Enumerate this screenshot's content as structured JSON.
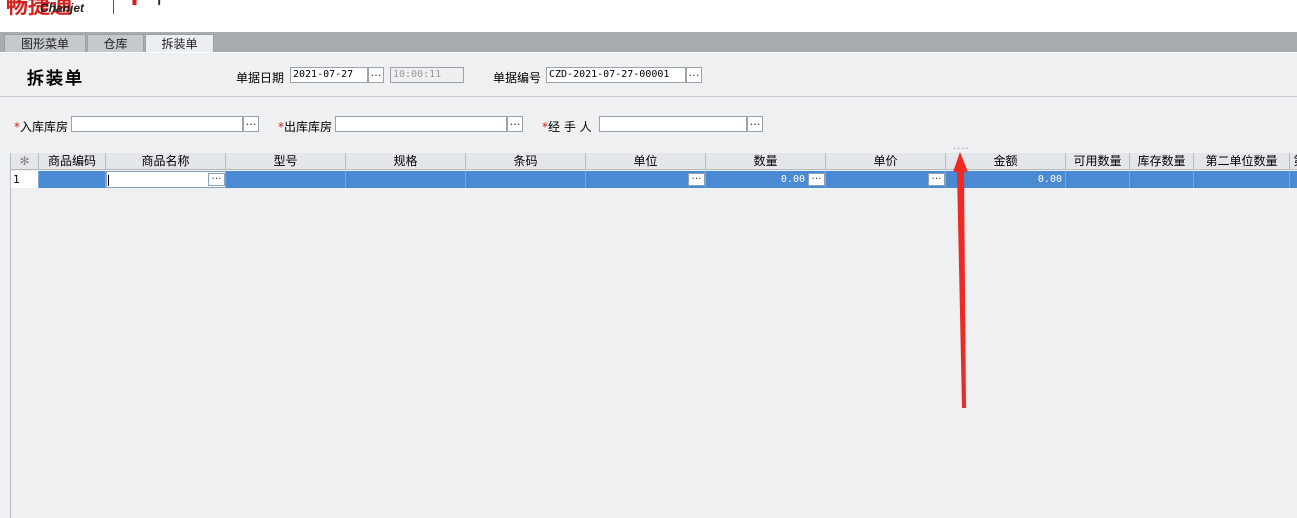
{
  "logo": {
    "brand_en": "Chanjet"
  },
  "tabs": [
    {
      "label": "图形菜单"
    },
    {
      "label": "仓库"
    },
    {
      "label": "拆装单"
    }
  ],
  "form": {
    "title": "拆装单",
    "date_label": "单据日期",
    "date_value": "2021-07-27",
    "time_value": "10:00:11",
    "number_label": "单据编号",
    "number_value": "CZD-2021-07-27-00001",
    "in_warehouse_label": "入库库房",
    "out_warehouse_label": "出库库房",
    "handler_label": "经 手 人",
    "required_mark": "*"
  },
  "grid": {
    "corner_symbol": "✻",
    "columns": [
      "商品编码",
      "商品名称",
      "型号",
      "规格",
      "条码",
      "单位",
      "数量",
      "单价",
      "金额",
      "可用数量",
      "库存数量",
      "第二单位数量",
      "第"
    ],
    "rows": [
      {
        "num": "1",
        "quantity": "0.00",
        "amount": "0.00"
      }
    ]
  },
  "ellipsis": "…",
  "colors": {
    "accent": "#4a8ad3",
    "required": "#d4211f",
    "arrow": "#ee2a24"
  }
}
